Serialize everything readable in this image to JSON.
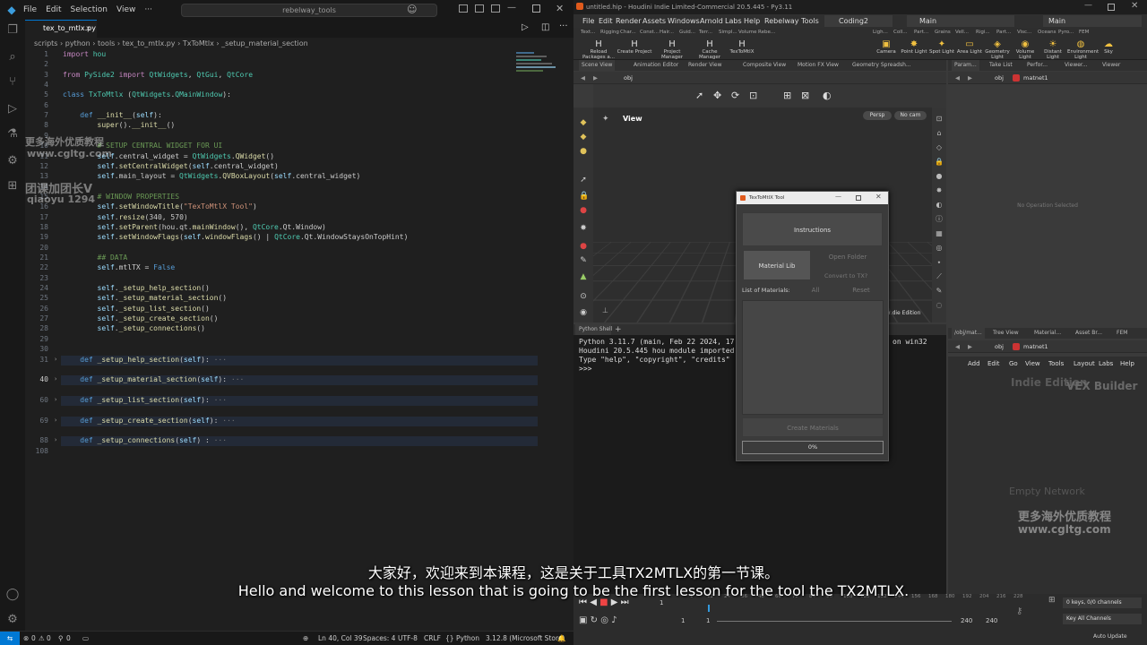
{
  "vscode": {
    "menu": [
      "File",
      "Edit",
      "Selection",
      "View"
    ],
    "search": "rebelway_tools",
    "tab": "tex_to_mtlx.py",
    "breadcrumb": "scripts › python › tools › tex_to_mtlx.py › TxToMtlx › _setup_material_section",
    "line_numbers": [
      "1",
      "2",
      "3",
      "4",
      "5",
      "6",
      "7",
      "8",
      "9",
      "10",
      "11",
      "12",
      "13",
      "14",
      "15",
      "16",
      "17",
      "18",
      "19",
      "20",
      "21",
      "22",
      "23",
      "24",
      "25",
      "26",
      "27",
      "28",
      "29",
      "30",
      "31",
      "40",
      "60",
      "69",
      "88",
      "108"
    ],
    "status": {
      "errors": "0",
      "warnings": "0",
      "ports": "0",
      "position": "Ln 40, Col 39",
      "spaces": "Spaces: 4",
      "encoding": "UTF-8",
      "eol": "CRLF",
      "lang": "Python",
      "interp": "3.12.8 (Microsoft Store)"
    }
  },
  "watermarks": [
    "更多海外优质教程",
    "www.cgltg.com",
    "团课加团长V",
    "qiaoyu 1294",
    "更多海外优质教程",
    "www.cgltg.com"
  ],
  "houdini": {
    "title": "untitled.hip - Houdini Indie Limited-Commercial 20.5.445 - Py3.11",
    "menu": [
      "File",
      "Edit",
      "Render",
      "Assets",
      "Windows",
      "Arnold",
      "Labs",
      "Help",
      "Rebelway Tools"
    ],
    "desktop": "Coding2",
    "main_left": "Main",
    "main_right": "Main",
    "shelf_tabs_left": [
      "Text...",
      "Rigging",
      "Char...",
      "Const...",
      "Hair...",
      "Guid...",
      "Terr...",
      "Simpl...",
      "Volume",
      "Rebe..."
    ],
    "shelf_tabs_right": [
      "Ligh...",
      "Coll...",
      "Part...",
      "Grains",
      "Vell...",
      "Rigi...",
      "Part...",
      "Visc...",
      "Oceans",
      "Pyro...",
      "FEM"
    ],
    "tools_left": [
      "Reload Packages a...",
      "Create Project",
      "Project Manager",
      "Cache Manager",
      "TexToMtlX"
    ],
    "tools_right": [
      "Camera",
      "Point Light",
      "Spot Light",
      "Area Light",
      "Geometry Light",
      "Volume Light",
      "Distant Light",
      "Environment Light",
      "Sky"
    ],
    "pane_tabs_top": [
      "Scene View",
      "Animation Editor",
      "Render View",
      "Composite View",
      "Motion FX View",
      "Geometry Spreadsh..."
    ],
    "pane_tabs_right": [
      "Param...",
      "Take List",
      "Perfor...",
      "Viewer...",
      "Viewer"
    ],
    "obj": "obj",
    "matnet": "matnet1",
    "view_label": "View",
    "persp": "Persp",
    "nocam": "No cam",
    "no_op": "No Operation Selected",
    "indie": "Indie Edition",
    "shell_tab": "Python Shell",
    "shell_lines": [
      "Python 3.11.7 (main, Feb 22 2024, 17",
      "Houdini 20.5.445 hou module imported",
      "Type \"help\", \"copyright\", \"credits\"",
      ">>>"
    ],
    "shell_right": "on win32",
    "net_tabs": [
      "/obj/mat...",
      "Tree View",
      "Material...",
      "Asset Br...",
      "FEM"
    ],
    "net_menu": [
      "Add",
      "Edit",
      "Go",
      "View",
      "Tools",
      "Layout",
      "Labs",
      "Help"
    ],
    "vex": "VEX Builder",
    "indie2": "Indie Edition",
    "empty": "Empty Network",
    "keys": "0 keys, 0/0 channels",
    "key_all": "Key All Channels",
    "auto_update": "Auto Update",
    "frame": "1",
    "frame_start": "1",
    "frame_end": "240",
    "frame_end2": "240",
    "ticks": [
      "1",
      "12",
      "24",
      "36",
      "48",
      "60",
      "72",
      "84",
      "96",
      "108",
      "120",
      "132",
      "144",
      "156",
      "168",
      "180",
      "192",
      "204",
      "216",
      "228"
    ]
  },
  "dialog": {
    "title": "TexToMtlX Tool",
    "instructions": "Instructions",
    "material_lib": "Material Lib",
    "open_folder": "Open Folder",
    "convert": "Convert to TX?",
    "list_label": "List of Materials:",
    "all": "All",
    "reset": "Reset",
    "create": "Create Materials",
    "progress": "0%"
  },
  "subtitles": {
    "zh": "大家好，欢迎来到本课程，这是关于工具TX2MTLX的第一节课。",
    "en": "Hello and welcome to this lesson that is going to be the first lesson for the tool the TX2MTLX."
  }
}
